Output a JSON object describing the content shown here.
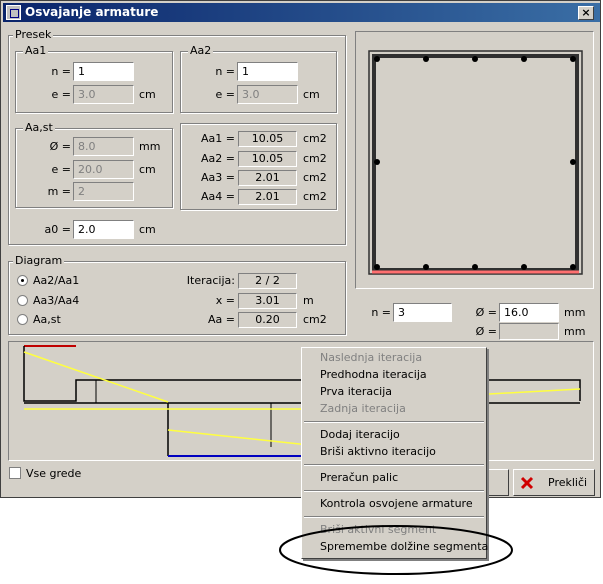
{
  "window": {
    "title": "Osvajanje armature",
    "close_glyph": "×"
  },
  "presek": {
    "label": "Presek",
    "aa1": {
      "label": "Aa1",
      "n_label": "n =",
      "n_value": "1",
      "e_label": "e =",
      "e_value": "3.0",
      "e_unit": "cm"
    },
    "aa2": {
      "label": "Aa2",
      "n_label": "n =",
      "n_value": "1",
      "e_label": "e =",
      "e_value": "3.0",
      "e_unit": "cm"
    },
    "aast": {
      "label": "Aa,st",
      "d_label": "Ø =",
      "d_value": "8.0",
      "d_unit": "mm",
      "e_label": "e =",
      "e_value": "20.0",
      "e_unit": "cm",
      "m_label": "m =",
      "m_value": "2"
    },
    "areas": [
      {
        "label": "Aa1 =",
        "value": "10.05",
        "unit": "cm2"
      },
      {
        "label": "Aa2 =",
        "value": "10.05",
        "unit": "cm2"
      },
      {
        "label": "Aa3 =",
        "value": "2.01",
        "unit": "cm2"
      },
      {
        "label": "Aa4 =",
        "value": "2.01",
        "unit": "cm2"
      }
    ],
    "a0": {
      "label": "a0 =",
      "value": "2.0",
      "unit": "cm"
    }
  },
  "diagram": {
    "label": "Diagram",
    "options": [
      {
        "label": "Aa2/Aa1",
        "selected": true
      },
      {
        "label": "Aa3/Aa4",
        "selected": false
      },
      {
        "label": "Aa,st",
        "selected": false
      }
    ],
    "iter_label": "Iteracija:",
    "iter_value": "2 / 2",
    "x_label": "x =",
    "x_value": "3.01",
    "x_unit": "m",
    "aa_label": "Aa =",
    "aa_value": "0.20",
    "aa_unit": "cm2"
  },
  "bars": {
    "n_label": "n =",
    "n_value": "3",
    "d1_label": "Ø =",
    "d1_value": "16.0",
    "d1_unit": "mm",
    "d2_label": "Ø =",
    "d2_value": "",
    "d2_unit": "mm"
  },
  "vse_grede": {
    "label": "Vse grede",
    "checked": false
  },
  "cancel_button": {
    "label": "Prekliči",
    "icon": "red-x-icon"
  },
  "context_menu": {
    "items": [
      {
        "label": "Naslednja iteracija",
        "enabled": false
      },
      {
        "label": "Predhodna iteracija",
        "enabled": true
      },
      {
        "label": "Prva iteracija",
        "enabled": true
      },
      {
        "label": "Zadnja iteracija",
        "enabled": false
      },
      {
        "label": "Dodaj iteracijo",
        "enabled": true
      },
      {
        "label": "Briši aktivno iteracijo",
        "enabled": true
      },
      {
        "label": "Preračun palic",
        "enabled": true
      },
      {
        "label": "Kontrola osvojene armature",
        "enabled": true
      },
      {
        "label": "Briši aktivni segment",
        "enabled": false
      },
      {
        "label": "Spremembe dolžine segmenta",
        "enabled": true
      }
    ]
  },
  "colors": {
    "title_bar": "#0a246a",
    "face": "#d4d0c8",
    "bottom_bar_line": "#ff7070",
    "diagram_red": "#c00000",
    "diagram_blue": "#0000c0",
    "diagram_yellow": "#ffff40",
    "annotation_ellipse": "#000000"
  }
}
